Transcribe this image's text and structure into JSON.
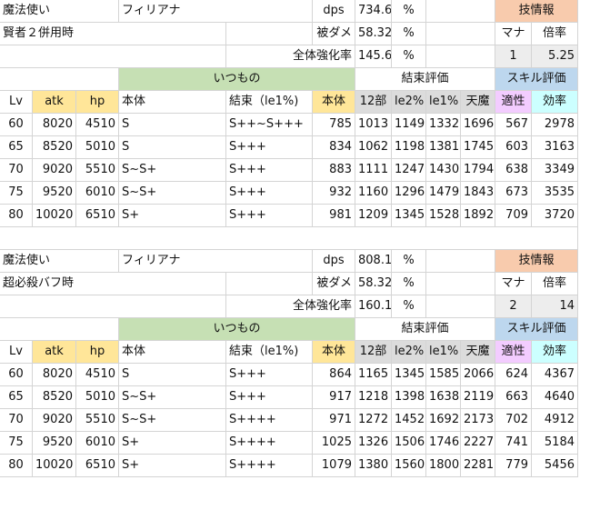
{
  "sections": [
    {
      "role": "魔法使い",
      "name": "フィリアナ",
      "condition": "賢者２併用時",
      "stats": [
        {
          "label": "dps",
          "value": "734.6",
          "unit": "%"
        },
        {
          "label": "被ダメ",
          "value": "58.32",
          "unit": "%"
        },
        {
          "label": "全体強化率",
          "value": "145.6",
          "unit": "%"
        }
      ],
      "skill_info": {
        "title": "技情報",
        "mana_label": "マナ",
        "mult_label": "倍率",
        "mana": "1",
        "mult": "5.25"
      },
      "group_headers": {
        "itsumono": "いつもの",
        "kessoku": "結束評価",
        "skill": "スキル評価"
      },
      "col_headers": [
        "Lv",
        "atk",
        "hp",
        "本体",
        "結束（le1%)",
        "本体",
        "12部",
        "le2%",
        "le1%",
        "天魔",
        "適性",
        "効率"
      ],
      "rows": [
        [
          "60",
          "8020",
          "4510",
          "S",
          "S++~S+++",
          "785",
          "1013",
          "1149",
          "1332",
          "1696",
          "567",
          "2978"
        ],
        [
          "65",
          "8520",
          "5010",
          "S",
          "S+++",
          "834",
          "1062",
          "1198",
          "1381",
          "1745",
          "603",
          "3163"
        ],
        [
          "70",
          "9020",
          "5510",
          "S~S+",
          "S+++",
          "883",
          "1111",
          "1247",
          "1430",
          "1794",
          "638",
          "3349"
        ],
        [
          "75",
          "9520",
          "6010",
          "S~S+",
          "S+++",
          "932",
          "1160",
          "1296",
          "1479",
          "1843",
          "673",
          "3535"
        ],
        [
          "80",
          "10020",
          "6510",
          "S+",
          "S+++",
          "981",
          "1209",
          "1345",
          "1528",
          "1892",
          "709",
          "3720"
        ]
      ]
    },
    {
      "role": "魔法使い",
      "name": "フィリアナ",
      "condition": "超必殺バフ時",
      "stats": [
        {
          "label": "dps",
          "value": "808.1",
          "unit": "%"
        },
        {
          "label": "被ダメ",
          "value": "58.32",
          "unit": "%"
        },
        {
          "label": "全体強化率",
          "value": "160.1",
          "unit": "%"
        }
      ],
      "skill_info": {
        "title": "技情報",
        "mana_label": "マナ",
        "mult_label": "倍率",
        "mana": "2",
        "mult": "14"
      },
      "group_headers": {
        "itsumono": "いつもの",
        "kessoku": "結束評価",
        "skill": "スキル評価"
      },
      "col_headers": [
        "Lv",
        "atk",
        "hp",
        "本体",
        "結束（le1%)",
        "本体",
        "12部",
        "le2%",
        "le1%",
        "天魔",
        "適性",
        "効率"
      ],
      "rows": [
        [
          "60",
          "8020",
          "4510",
          "S",
          "S+++",
          "864",
          "1165",
          "1345",
          "1585",
          "2066",
          "624",
          "4367"
        ],
        [
          "65",
          "8520",
          "5010",
          "S~S+",
          "S+++",
          "917",
          "1218",
          "1398",
          "1638",
          "2119",
          "663",
          "4640"
        ],
        [
          "70",
          "9020",
          "5510",
          "S~S+",
          "S++++",
          "971",
          "1272",
          "1452",
          "1692",
          "2173",
          "702",
          "4912"
        ],
        [
          "75",
          "9520",
          "6010",
          "S+",
          "S++++",
          "1025",
          "1326",
          "1506",
          "1746",
          "2227",
          "741",
          "5184"
        ],
        [
          "80",
          "10020",
          "6510",
          "S+",
          "S++++",
          "1079",
          "1380",
          "1560",
          "1800",
          "2281",
          "779",
          "5456"
        ]
      ]
    }
  ]
}
